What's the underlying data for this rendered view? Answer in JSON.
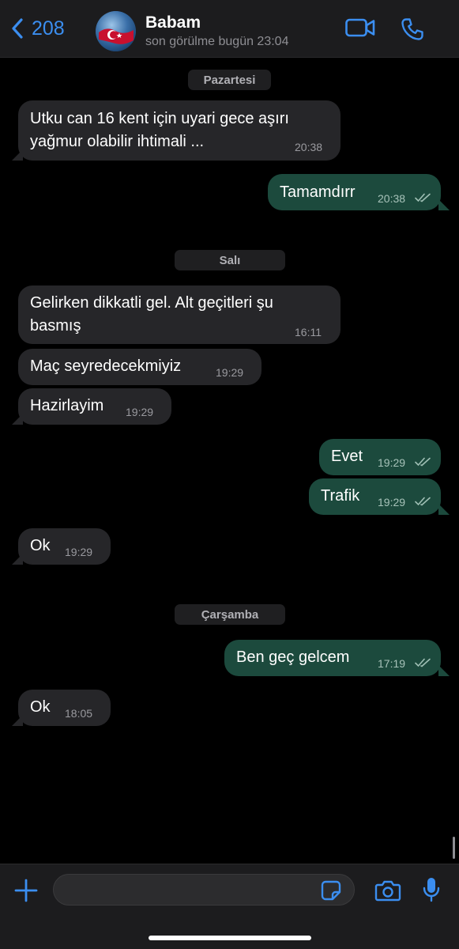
{
  "header": {
    "back_count": "208",
    "contact_name": "Babam",
    "status": "son görülme bugün 23:04"
  },
  "days": {
    "d1": "Pazartesi",
    "d2": "Salı",
    "d3": "Çarşamba"
  },
  "messages": [
    {
      "direction": "in",
      "lines": [
        "Utku can 16 kent için uyari gece aşırı",
        "yağmur olabilir ihtimali ..."
      ],
      "time": "20:38"
    },
    {
      "direction": "out",
      "lines": [
        "Tamamdırr"
      ],
      "time": "20:38",
      "read": true
    },
    {
      "direction": "in",
      "lines": [
        "Gelirken dikkatli gel. Alt geçitleri şu",
        "basmış"
      ],
      "time": "16:11"
    },
    {
      "direction": "in",
      "lines": [
        "Maç seyredecekmiyiz"
      ],
      "time": "19:29"
    },
    {
      "direction": "in",
      "lines": [
        "Hazirlayim"
      ],
      "time": "19:29"
    },
    {
      "direction": "out",
      "lines": [
        "Evet"
      ],
      "time": "19:29",
      "read": true
    },
    {
      "direction": "out",
      "lines": [
        "Trafik"
      ],
      "time": "19:29",
      "read": true
    },
    {
      "direction": "in",
      "lines": [
        "Ok"
      ],
      "time": "19:29"
    },
    {
      "direction": "out",
      "lines": [
        "Ben geç gelcem"
      ],
      "time": "17:19",
      "read": true
    },
    {
      "direction": "in",
      "lines": [
        "Ok"
      ],
      "time": "18:05"
    }
  ],
  "composer": {
    "placeholder": ""
  },
  "icons": {
    "back": "chevron-left-icon",
    "video": "video-camera-icon",
    "phone": "phone-icon",
    "plus": "plus-icon",
    "sticker": "sticker-icon",
    "camera": "camera-icon",
    "mic": "microphone-icon",
    "read_receipt": "double-check-icon"
  },
  "colors": {
    "accent": "#3b8ef0",
    "incoming_bubble": "#262629",
    "outgoing_bubble": "#1c4a3d",
    "background": "#000000"
  }
}
